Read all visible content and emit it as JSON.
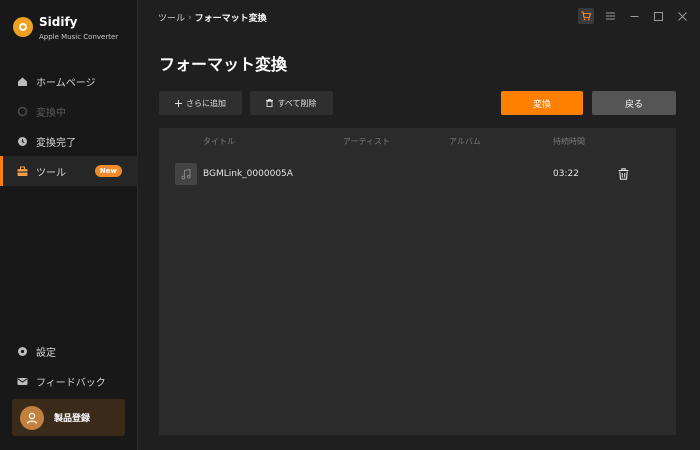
{
  "brand": {
    "name": "Sidify",
    "subtitle": "Apple Music Converter",
    "accent_color": "#ff8000"
  },
  "sidebar": {
    "items": [
      {
        "label": "ホームページ",
        "icon": "home-icon",
        "state": "normal"
      },
      {
        "label": "変換中",
        "icon": "converting-icon",
        "state": "disabled"
      },
      {
        "label": "変換完了",
        "icon": "clock-icon",
        "state": "normal"
      },
      {
        "label": "ツール",
        "icon": "toolbox-icon",
        "state": "active",
        "badge": "New"
      }
    ],
    "bottom_items": [
      {
        "label": "設定",
        "icon": "gear-icon"
      },
      {
        "label": "フィードバック",
        "icon": "mail-icon"
      }
    ],
    "register_label": "製品登録"
  },
  "topbar": {
    "breadcrumb_parent": "ツール",
    "breadcrumb_separator": "›",
    "breadcrumb_current": "フォーマット変換",
    "window_controls": [
      "cart-icon",
      "menu-icon",
      "minimize-icon",
      "maximize-icon",
      "close-icon"
    ]
  },
  "main": {
    "title": "フォーマット変換",
    "toolbar": {
      "add_label": "さらに追加",
      "delete_all_label": "すべて削除",
      "convert_label": "変換",
      "back_label": "戻る"
    },
    "columns": {
      "title": "タイトル",
      "artist": "アーティスト",
      "album": "アルバム",
      "duration": "持続時間"
    },
    "rows": [
      {
        "title": "BGMLink_0000005A",
        "artist": "",
        "album": "",
        "duration": "03:22"
      }
    ]
  }
}
